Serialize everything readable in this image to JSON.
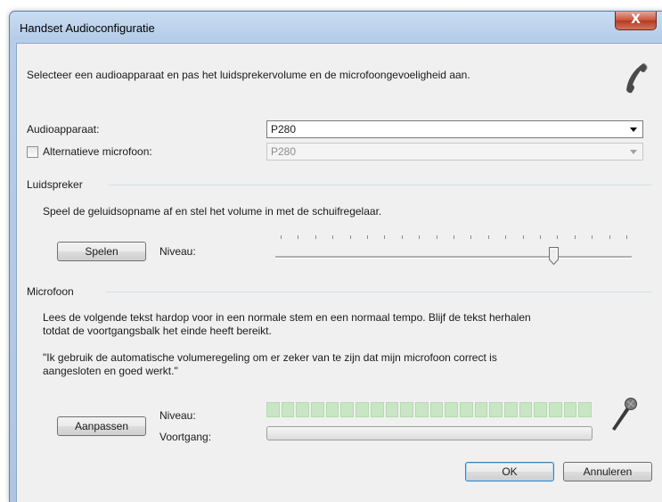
{
  "window": {
    "title": "Handset Audioconfiguratie",
    "close_glyph": "X"
  },
  "intro": "Selecteer een audioapparaat en pas het luidsprekervolume en de microfoongevoeligheid aan.",
  "audio_device": {
    "label": "Audioapparaat:",
    "value": "P280"
  },
  "alt_mic": {
    "label": "Alternatieve microfoon:",
    "value": "P280",
    "checked": false
  },
  "speaker": {
    "group_label": "Luidspreker",
    "instructions": "Speel de geluidsopname af en stel het volume in met de schuifregelaar.",
    "play_button": "Spelen",
    "level_label": "Niveau:",
    "volume_level": 0.78
  },
  "microphone": {
    "group_label": "Microfoon",
    "instructions_line1": "Lees de volgende tekst hardop voor in een normale stem en een normaal tempo. Blijf de tekst herhalen",
    "instructions_line2": "totdat de voortgangsbalk het einde heeft bereikt.",
    "quote_line1": "\"Ik gebruik de automatische volumeregeling om er zeker van te zijn dat mijn microfoon correct is",
    "quote_line2": "aangesloten en goed werkt.\"",
    "adjust_button": "Aanpassen",
    "level_label": "Niveau:",
    "progress_label": "Voortgang:",
    "progress_value": 0
  },
  "footer": {
    "ok": "OK",
    "cancel": "Annuleren"
  },
  "icons": {
    "header": "phone-handset-icon",
    "mic": "microphone-icon"
  },
  "colors": {
    "level_segment": "#c8e6c4",
    "titlebar": "#c9dcf2",
    "close": "#c7523a"
  }
}
